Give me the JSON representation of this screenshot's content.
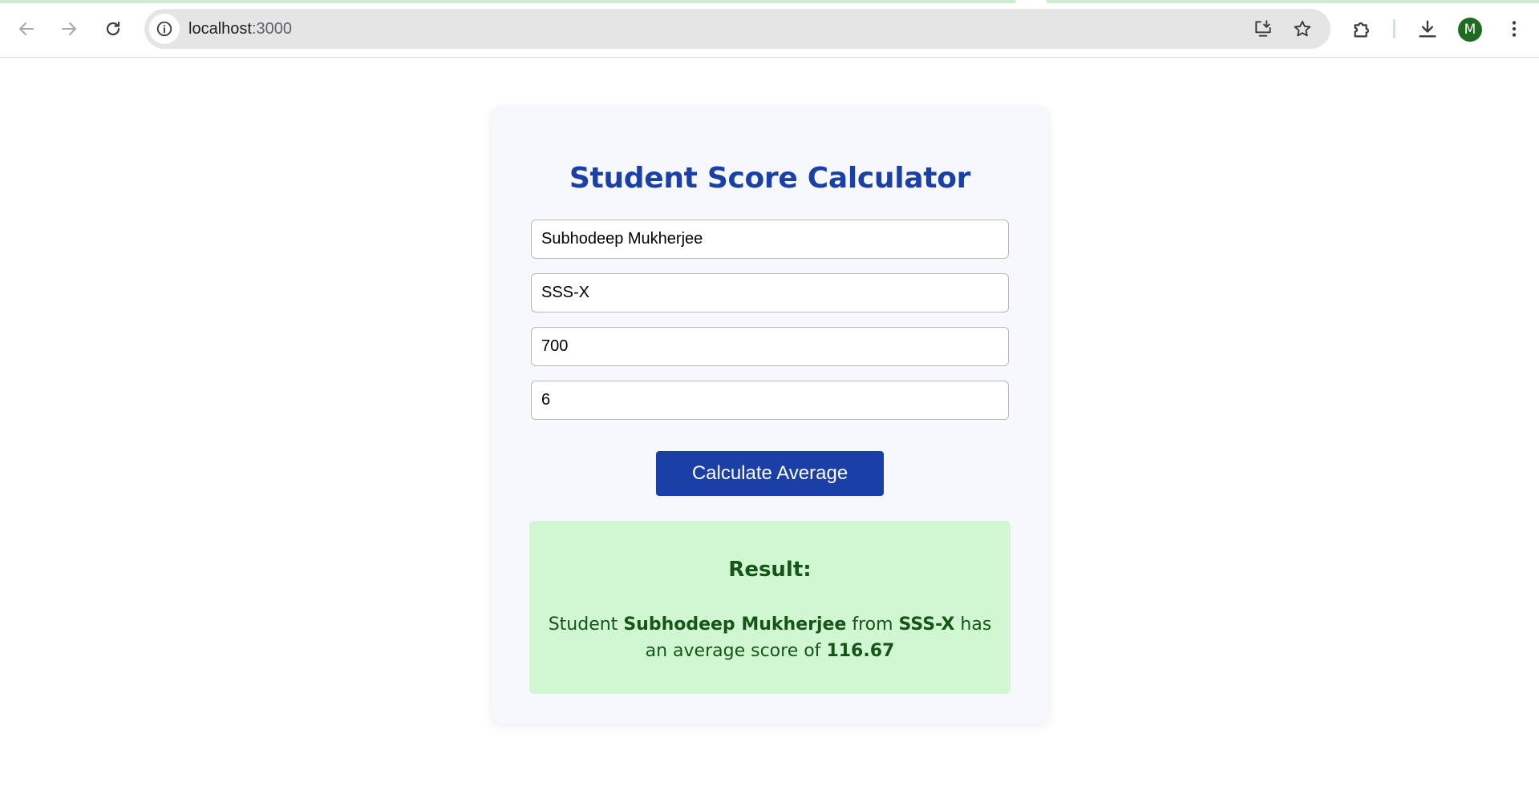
{
  "browser": {
    "url_host": "localhost",
    "url_port": ":3000",
    "profile_initial": "M"
  },
  "app": {
    "title": "Student Score Calculator",
    "fields": {
      "name": "Subhodeep Mukherjee",
      "class_name": "SSS-X",
      "total_score": "700",
      "subjects": "6"
    },
    "button_label": "Calculate Average",
    "result": {
      "heading": "Result:",
      "prefix": "Student",
      "name": "Subhodeep Mukherjee",
      "from_word": "from",
      "class_name": "SSS-X",
      "middle": "has an average score of",
      "average": "116.67"
    }
  },
  "colors": {
    "accent": "#1a3fa6",
    "result_bg": "#d1f7d2",
    "result_text": "#155618",
    "avatar_bg": "#1f6b22"
  }
}
